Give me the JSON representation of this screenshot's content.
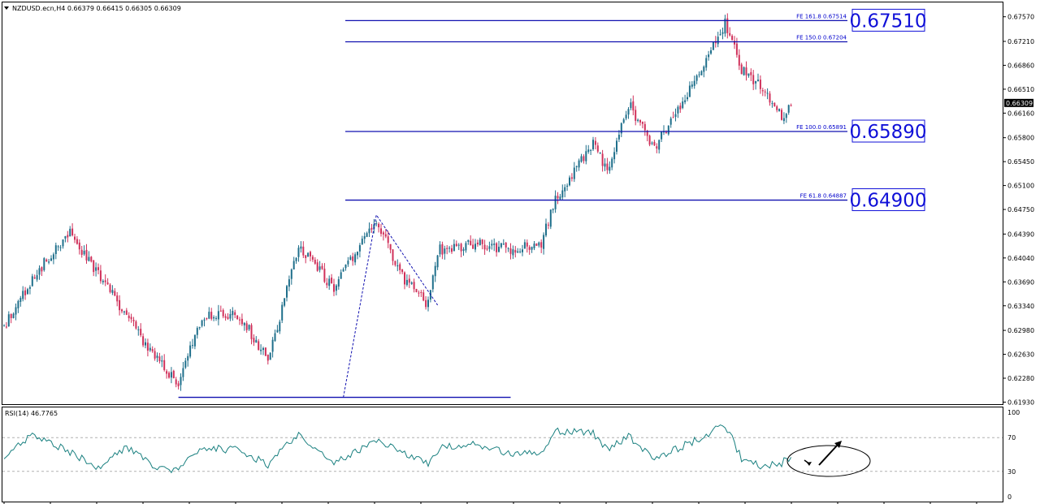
{
  "header": {
    "symbol_line": "NZDUSD.ecn,H4  0.66379 0.66415 0.66305 0.66309",
    "rsi_label": "RSI(14) 46.7765"
  },
  "colors": {
    "bull": "#1f6f8b",
    "bear": "#d0305a",
    "fib_line": "#1010b0",
    "rsi_line": "#1a8080",
    "label_border": "#1010d8",
    "annotation": "#000000"
  },
  "chart_data": [
    {
      "type": "candlestick",
      "title": "NZDUSD.ecn,H4",
      "ylim": [
        0.619,
        0.6778
      ],
      "price_ticks": [
        "0.67570",
        "0.67210",
        "0.66860",
        "0.66510",
        "0.66160",
        "0.65800",
        "0.65450",
        "0.65100",
        "0.64750",
        "0.64390",
        "0.64040",
        "0.63690",
        "0.63340",
        "0.62980",
        "0.62630",
        "0.62280",
        "0.61930"
      ],
      "current_price": "0.66309",
      "keypoints": [
        {
          "bar": 0,
          "price": 0.6305
        },
        {
          "bar": 13,
          "price": 0.638
        },
        {
          "bar": 28,
          "price": 0.644
        },
        {
          "bar": 45,
          "price": 0.6355
        },
        {
          "bar": 62,
          "price": 0.6268
        },
        {
          "bar": 74,
          "price": 0.6218
        },
        {
          "bar": 84,
          "price": 0.632
        },
        {
          "bar": 100,
          "price": 0.632
        },
        {
          "bar": 112,
          "price": 0.6255
        },
        {
          "bar": 125,
          "price": 0.642
        },
        {
          "bar": 140,
          "price": 0.636
        },
        {
          "bar": 158,
          "price": 0.646
        },
        {
          "bar": 168,
          "price": 0.638
        },
        {
          "bar": 180,
          "price": 0.6335
        },
        {
          "bar": 184,
          "price": 0.6415
        },
        {
          "bar": 200,
          "price": 0.6425
        },
        {
          "bar": 215,
          "price": 0.6415
        },
        {
          "bar": 228,
          "price": 0.6425
        },
        {
          "bar": 234,
          "price": 0.649
        },
        {
          "bar": 250,
          "price": 0.6575
        },
        {
          "bar": 256,
          "price": 0.653
        },
        {
          "bar": 265,
          "price": 0.663
        },
        {
          "bar": 276,
          "price": 0.6565
        },
        {
          "bar": 296,
          "price": 0.668
        },
        {
          "bar": 306,
          "price": 0.6748
        },
        {
          "bar": 313,
          "price": 0.668
        },
        {
          "bar": 322,
          "price": 0.6655
        },
        {
          "bar": 330,
          "price": 0.661
        },
        {
          "bar": 334,
          "price": 0.6631
        }
      ],
      "fibonacci": [
        {
          "label": "FE 161.8  0.67514",
          "price": 0.67514,
          "big_label": "0.67510"
        },
        {
          "label": "FE 150.0  0.67204",
          "price": 0.67204,
          "big_label": ""
        },
        {
          "label": "FE 100.0  0.65891",
          "price": 0.65891,
          "big_label": "0.65890"
        },
        {
          "label": "FE 61.8  0.64887",
          "price": 0.64887,
          "big_label": "0.64900"
        }
      ],
      "fib_anchor_low": 0.62,
      "fib_anchor_high": 0.6467,
      "fib_anchor_pullback": 0.6335
    },
    {
      "type": "line",
      "name": "RSI(14)",
      "value": 46.7765,
      "ylim": [
        0,
        100
      ],
      "ticks": [
        "100",
        "70",
        "30",
        "0"
      ],
      "levels": [
        70,
        30
      ],
      "keypoints": [
        {
          "bar": 0,
          "value": 45
        },
        {
          "bar": 12,
          "value": 75
        },
        {
          "bar": 40,
          "value": 35
        },
        {
          "bar": 52,
          "value": 58
        },
        {
          "bar": 64,
          "value": 35
        },
        {
          "bar": 74,
          "value": 32
        },
        {
          "bar": 84,
          "value": 58
        },
        {
          "bar": 100,
          "value": 55
        },
        {
          "bar": 112,
          "value": 38
        },
        {
          "bar": 125,
          "value": 75
        },
        {
          "bar": 140,
          "value": 40
        },
        {
          "bar": 158,
          "value": 65
        },
        {
          "bar": 168,
          "value": 55
        },
        {
          "bar": 180,
          "value": 38
        },
        {
          "bar": 186,
          "value": 60
        },
        {
          "bar": 200,
          "value": 62
        },
        {
          "bar": 215,
          "value": 50
        },
        {
          "bar": 228,
          "value": 52
        },
        {
          "bar": 234,
          "value": 78
        },
        {
          "bar": 250,
          "value": 75
        },
        {
          "bar": 256,
          "value": 55
        },
        {
          "bar": 265,
          "value": 72
        },
        {
          "bar": 276,
          "value": 45
        },
        {
          "bar": 296,
          "value": 70
        },
        {
          "bar": 306,
          "value": 86
        },
        {
          "bar": 313,
          "value": 45
        },
        {
          "bar": 322,
          "value": 35
        },
        {
          "bar": 330,
          "value": 40
        },
        {
          "bar": 334,
          "value": 46.8
        }
      ]
    }
  ]
}
